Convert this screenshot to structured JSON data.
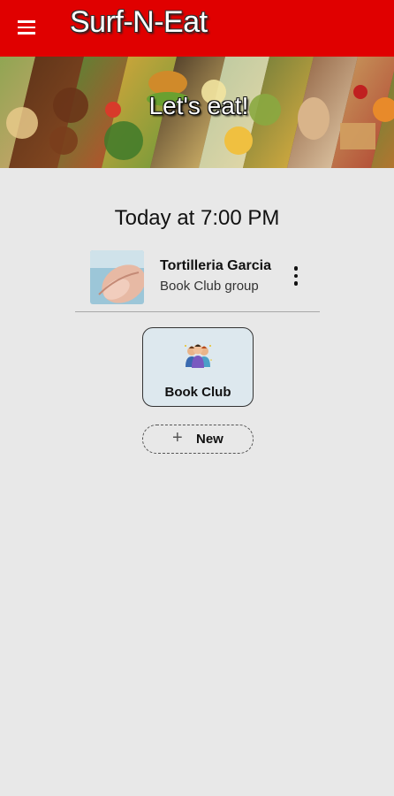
{
  "app": {
    "title": "Surf-N-Eat",
    "brand_color": "#e00000"
  },
  "icons": {
    "menu": "hamburger-menu-icon",
    "more": "vertical-dots-icon",
    "group": "people-group-icon",
    "add": "plus-icon"
  },
  "banner": {
    "text": "Let's eat!"
  },
  "event": {
    "time": "Today at 7:00 PM",
    "restaurant": "Tortilleria Garcia",
    "group": "Book Club group"
  },
  "groups": [
    {
      "label": "Book Club"
    }
  ],
  "new_button": {
    "label": "New",
    "icon_glyph": "+"
  }
}
